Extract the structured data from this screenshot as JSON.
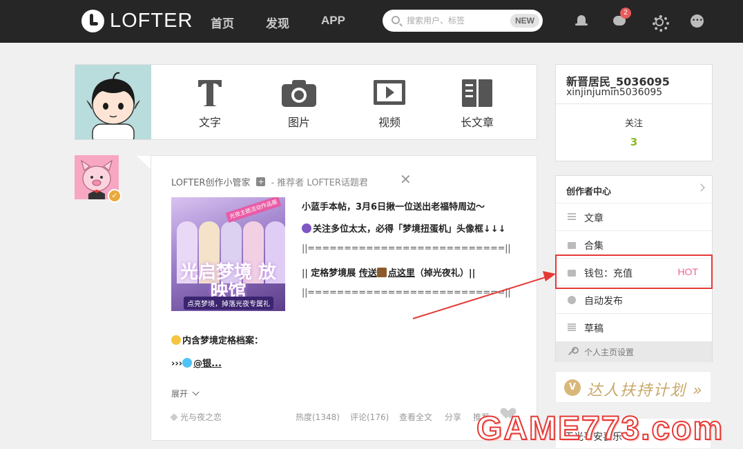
{
  "topbar": {
    "logo_text": "LOFTER",
    "nav": [
      "首页",
      "发现",
      "APP"
    ],
    "search_placeholder": "搜索用户、标签",
    "search_badge": "NEW",
    "message_count": "2"
  },
  "publish": {
    "buttons": [
      {
        "label": "文字",
        "icon": "text-icon"
      },
      {
        "label": "图片",
        "icon": "camera-icon"
      },
      {
        "label": "视频",
        "icon": "video-icon"
      },
      {
        "label": "长文章",
        "icon": "long-article-icon"
      }
    ]
  },
  "post": {
    "author": "LOFTER创作小管家",
    "plus": "+",
    "recommender": "- 推荐者 LOFTER话题君",
    "close": "✕",
    "cover": {
      "tag": "光夜主题活动作品展",
      "title": "光启梦境 放映馆",
      "subtitle": "点亮梦境，掉落光夜专属礼"
    },
    "lines": [
      "小蓝手本帖，3月6日揪一位送出老福特周边～",
      "关注多位太太，必得「梦境扭蛋机」头像框↓↓↓",
      "||===========================||",
      "||",
      "定格梦境展",
      "传送",
      "点这里",
      "（掉光夜礼）||",
      "||===========================||"
    ],
    "archive_line": "内含梦境定格档案：",
    "link_prefix": "›››",
    "link": "@银...",
    "expand": "展开",
    "tag": "光与夜之恋",
    "stats": [
      "热度(1348)",
      "评论(176)",
      "查看全文",
      "分享",
      "推荐"
    ]
  },
  "profile": {
    "nickname": "新晋居民_5036095",
    "username": "xinjinjumin5036095",
    "follow_label": "关注",
    "follow_count": "3"
  },
  "menu": {
    "header": "创作者中心",
    "items": [
      {
        "label": "文章",
        "icon": "article-icon"
      },
      {
        "label": "合集",
        "icon": "folder-icon"
      },
      {
        "label": "钱包：充值",
        "icon": "wallet-icon",
        "badge": "HOT"
      },
      {
        "label": "自动发布",
        "icon": "clock-icon"
      },
      {
        "label": "草稿",
        "icon": "draft-icon"
      }
    ],
    "settings": "个人主页设置"
  },
  "promo": {
    "badge": "V",
    "text": "达人扶持计划 »"
  },
  "bottom_card": {
    "label": "天光平安喜乐"
  },
  "watermark": "GAME773.com",
  "colors": {
    "topbar": "#262626",
    "accent_green": "#8ab821",
    "hot": "#f06292",
    "annotation_red": "#e53935"
  }
}
